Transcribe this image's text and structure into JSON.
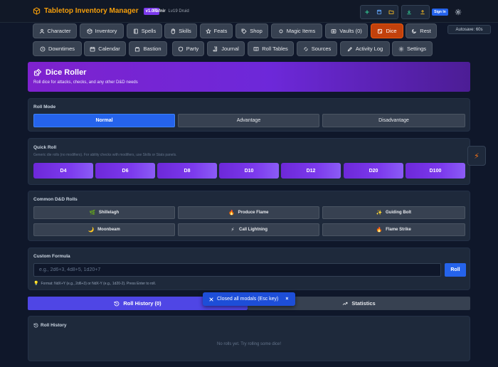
{
  "app": {
    "title": "Tabletop Inventory Manager",
    "version": "v1.0.0"
  },
  "character": {
    "name": "Fafnir",
    "meta": "Lv19 Druid"
  },
  "toolbar": {
    "signin_label": "Sign In",
    "autosave": "Autosave: 60s"
  },
  "nav_row1": [
    {
      "label": "Character",
      "icon": "user-icon"
    },
    {
      "label": "Inventory",
      "icon": "package-icon"
    },
    {
      "label": "Spells",
      "icon": "book-icon"
    },
    {
      "label": "Skills",
      "icon": "hand-icon"
    },
    {
      "label": "Feats",
      "icon": "star-icon"
    },
    {
      "label": "Shop",
      "icon": "tag-icon"
    },
    {
      "label": "Magic Items",
      "icon": "sparkle-icon"
    },
    {
      "label": "Vaults (0)",
      "icon": "vault-icon"
    },
    {
      "label": "Dice",
      "icon": "dice-icon"
    },
    {
      "label": "Rest",
      "icon": "moon-icon"
    }
  ],
  "nav_row2": [
    {
      "label": "Downtimes",
      "icon": "clock-icon"
    },
    {
      "label": "Calendar",
      "icon": "calendar-icon"
    },
    {
      "label": "Bastion",
      "icon": "castle-icon"
    },
    {
      "label": "Party",
      "icon": "shield-icon"
    },
    {
      "label": "Journal",
      "icon": "scroll-icon"
    },
    {
      "label": "Roll Tables",
      "icon": "table-book-icon"
    },
    {
      "label": "Sources",
      "icon": "sources-icon"
    },
    {
      "label": "Activity Log",
      "icon": "pencil-icon"
    },
    {
      "label": "Settings",
      "icon": "gear-icon"
    }
  ],
  "header": {
    "title": "Dice Roller",
    "subtitle": "Roll dice for attacks, checks, and any other D&D needs"
  },
  "roll_mode": {
    "title": "Roll Mode",
    "options": [
      "Normal",
      "Advantage",
      "Disadvantage"
    ],
    "selected": "Normal"
  },
  "quick_roll": {
    "title": "Quick Roll",
    "hint": "Generic die rolls (no modifiers). For ability checks with modifiers, use Skills or Stats panels.",
    "dice": [
      "D4",
      "D6",
      "D8",
      "D10",
      "D12",
      "D20",
      "D100"
    ]
  },
  "common_rolls": {
    "title": "Common D&D Rolls",
    "items": [
      {
        "label": "Shillelagh",
        "icon": "leaf-icon",
        "glyph": "🌿"
      },
      {
        "label": "Produce Flame",
        "icon": "flame-icon",
        "glyph": "🔥"
      },
      {
        "label": "Guiding Bolt",
        "icon": "sparkle-icon",
        "glyph": "✨"
      },
      {
        "label": "Moonbeam",
        "icon": "moon-icon",
        "glyph": "🌙"
      },
      {
        "label": "Call Lightning",
        "icon": "lightning-icon",
        "glyph": "⚡"
      },
      {
        "label": "Flame Strike",
        "icon": "flame-icon",
        "glyph": "🔥"
      }
    ]
  },
  "custom": {
    "title": "Custom Formula",
    "placeholder": "e.g., 2d6+3, 4d8+5, 1d20+7",
    "roll_label": "Roll",
    "hint": "Format: NdX+Y (e.g., 2d6+3) or NdX-Y (e.g., 1d20-2). Press Enter to roll."
  },
  "tabs": {
    "history": "Roll History (0)",
    "stats": "Statistics"
  },
  "toast": {
    "text": "Closed all modals (Esc key)",
    "close": "×"
  },
  "history": {
    "title": "Roll History",
    "empty": "No rolls yet. Try rolling some dice!"
  },
  "colors": {
    "accent": "#2563eb",
    "dice_active": "#c2410c",
    "purple": "#7c3aed",
    "brand": "#f59e0b"
  }
}
